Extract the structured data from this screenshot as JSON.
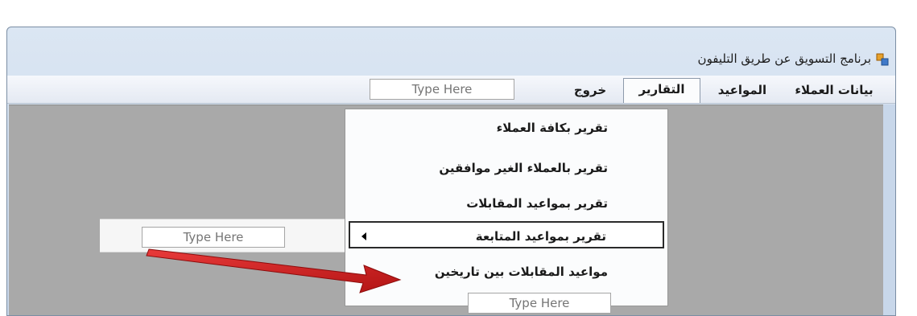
{
  "window": {
    "title": "برنامج التسويق عن طريق التليفون"
  },
  "menubar": {
    "items": [
      {
        "label": "بيانات العملاء"
      },
      {
        "label": "المواعيد"
      },
      {
        "label": "التقارير"
      },
      {
        "label": "خروج"
      }
    ],
    "type_here": "Type Here"
  },
  "dropdown": {
    "items": [
      {
        "label": "تقرير بكافة العملاء"
      },
      {
        "label": "تقرير بالعملاء الغير موافقين"
      },
      {
        "label": "تقرير بمواعيد المقابلات"
      },
      {
        "label": "تقرير بمواعيد المتابعة"
      },
      {
        "label": "مواعيد المقابلات بين تاريخين"
      }
    ],
    "type_here": "Type Here"
  },
  "submenu": {
    "type_here": "Type Here"
  },
  "colors": {
    "arrow": "#d42020",
    "client_area": "#a9a9a9"
  }
}
